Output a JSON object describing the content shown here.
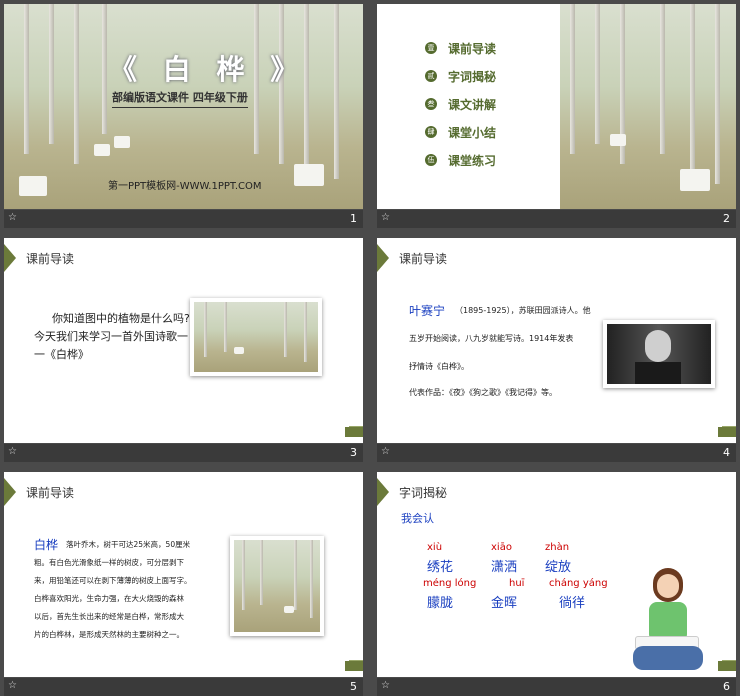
{
  "slides": [
    {
      "num": "1",
      "title": "《 白 桦 》",
      "subtitle": "部编版语文课件 四年级下册",
      "site": "第一PPT模板网-WWW.1PPT.COM"
    },
    {
      "num": "2",
      "toc": [
        {
          "dot": "壹",
          "label": "课前导读"
        },
        {
          "dot": "贰",
          "label": "字词揭秘"
        },
        {
          "dot": "叁",
          "label": "课文讲解"
        },
        {
          "dot": "肆",
          "label": "课堂小结"
        },
        {
          "dot": "伍",
          "label": "课堂练习"
        }
      ]
    },
    {
      "num": "3",
      "header": "课前导读",
      "body": [
        "你知道图中的植物是什么吗?",
        "今天我们来学习一首外国诗歌一",
        "一《白桦》"
      ]
    },
    {
      "num": "4",
      "header": "课前导读",
      "name": "叶赛宁",
      "lines": [
        "（1895-1925），苏联田园派诗人。他",
        "五岁开始阅读，八九岁就能写诗。1914年发表",
        "抒情诗《白桦》。",
        "代表作品：《夜》《狗之歌》《我记得》等。"
      ]
    },
    {
      "num": "5",
      "header": "课前导读",
      "name": "白桦",
      "lines": [
        "落叶乔木，树干可达25米高，50厘米",
        "粗。有白色光滑象纸一样的树皮，可分层剥下",
        "来，用铅笔还可以在剥下薄薄的树皮上面写字。",
        "白桦喜欢阳光，生命力强，在大火烧毁的森林",
        "以后，首先生长出来的经常是白桦，常形成大",
        "片的白桦林，是形成天然林的主要树种之一。"
      ]
    },
    {
      "num": "6",
      "header": "字词揭秘",
      "intro": "我会认",
      "words": [
        {
          "py": "xiù",
          "hz": "绣花"
        },
        {
          "py": "xiāo",
          "hz": "潇洒"
        },
        {
          "py": "zhàn",
          "hz": "绽放"
        },
        {
          "py": "méng lóng",
          "hz": "朦胧"
        },
        {
          "py": "huī",
          "hz": "金晖"
        },
        {
          "py": "cháng yáng",
          "hz": "徜徉"
        }
      ]
    }
  ]
}
